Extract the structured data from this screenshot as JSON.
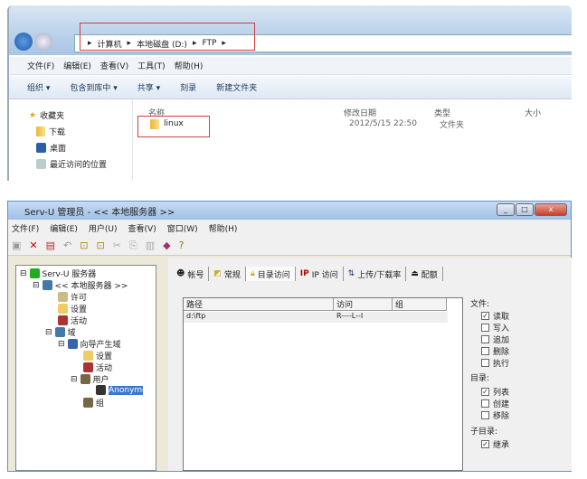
{
  "explorer": {
    "breadcrumb": [
      "计算机",
      "本地磁盘 (D:)",
      "FTP"
    ],
    "menu": [
      "文件(F)",
      "编辑(E)",
      "查看(V)",
      "工具(T)",
      "帮助(H)"
    ],
    "toolbar": [
      "组织 ▾",
      "包含到库中 ▾",
      "共享 ▾",
      "刻录",
      "新建文件夹"
    ],
    "nav": [
      "收藏夹",
      "下载",
      "桌面",
      "最近访问的位置"
    ],
    "columns": [
      "名称",
      "修改日期",
      "类型",
      "大小"
    ],
    "row": {
      "name": "linux",
      "modified": "2012/5/15 22:50",
      "type": "文件夹",
      "size": ""
    }
  },
  "servu": {
    "title": "Serv-U 管理员 - << 本地服务器 >>",
    "menu": [
      "文件(F)",
      "编辑(E)",
      "用户(U)",
      "查看(V)",
      "窗口(W)",
      "帮助(H)"
    ],
    "tree": [
      "Serv-U 服务器",
      "<< 本地服务器 >>",
      "许可",
      "设置",
      "活动",
      "域",
      "向导产生域",
      "设置",
      "活动",
      "用户",
      "Anonymous",
      "组"
    ],
    "tabs": [
      "帐号",
      "常规",
      "目录访问",
      "IP 访问",
      "上传/下载率",
      "配额"
    ],
    "list_columns": [
      "路径",
      "访问",
      "组"
    ],
    "list_row": {
      "path": "d:\\ftp",
      "access": "R----L--I",
      "group": ""
    },
    "perm": {
      "file_label": "文件:",
      "file": [
        {
          "label": "读取",
          "checked": true
        },
        {
          "label": "写入",
          "checked": false
        },
        {
          "label": "追加",
          "checked": false
        },
        {
          "label": "删除",
          "checked": false
        },
        {
          "label": "执行",
          "checked": false
        }
      ],
      "dir_label": "目录:",
      "dir": [
        {
          "label": "列表",
          "checked": true
        },
        {
          "label": "创建",
          "checked": false
        },
        {
          "label": "移除",
          "checked": false
        }
      ],
      "sub_label": "子目录:",
      "sub": [
        {
          "label": "继承",
          "checked": true
        }
      ]
    }
  }
}
